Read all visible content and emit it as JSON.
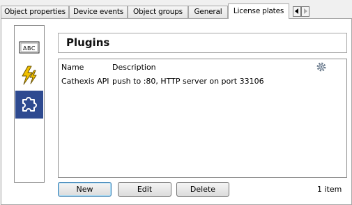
{
  "tabs": [
    {
      "label": "Object properties",
      "active": false
    },
    {
      "label": "Device events",
      "active": false
    },
    {
      "label": "Object groups",
      "active": false
    },
    {
      "label": "General",
      "active": false
    },
    {
      "label": "License plates",
      "active": true
    }
  ],
  "sidebar": {
    "items": [
      {
        "icon": "abc-text-icon",
        "label": "ABC",
        "selected": false
      },
      {
        "icon": "lightning-icon",
        "selected": false
      },
      {
        "icon": "puzzle-piece-icon",
        "selected": true
      }
    ]
  },
  "header": {
    "title": "Plugins"
  },
  "list": {
    "columns": [
      "Name",
      "Description"
    ],
    "settings_icon": "gear-icon",
    "rows": [
      {
        "name": "Cathexis API",
        "description": "push to :80, HTTP server on port 33106"
      }
    ]
  },
  "buttons": {
    "new_label": "New",
    "edit_label": "Edit",
    "delete_label": "Delete"
  },
  "status": {
    "count_text": "1 item"
  },
  "colors": {
    "selected_bg": "#2e4a90",
    "lightning": "#f0c000"
  }
}
